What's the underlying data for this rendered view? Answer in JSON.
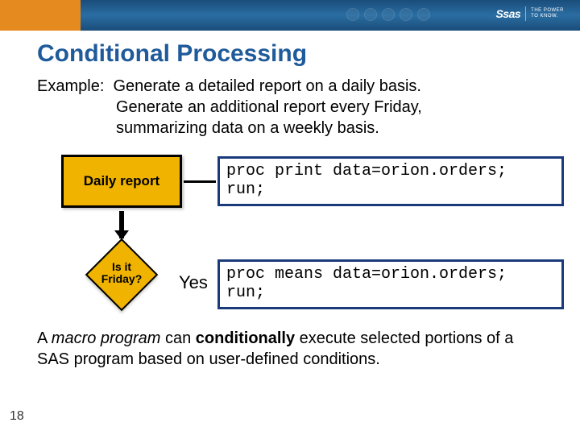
{
  "header": {
    "logo_brand": "Ssas",
    "logo_tag_line1": "THE POWER",
    "logo_tag_line2": "TO KNOW."
  },
  "title": "Conditional Processing",
  "example": {
    "label": "Example:",
    "line1": "Generate a detailed report on a daily basis.",
    "line2": "Generate an additional report every Friday,",
    "line3": "summarizing data on a weekly basis."
  },
  "diagram": {
    "daily_report": "Daily report",
    "code1_line1": "proc print data=orion.orders;",
    "code1_line2": "run;",
    "decision_line1": "Is it",
    "decision_line2": "Friday?",
    "yes": "Yes",
    "code2_line1": "proc means data=orion.orders;",
    "code2_line2": "run;"
  },
  "footer": {
    "part1": "A ",
    "macro_program": "macro program",
    "part2": " can ",
    "conditionally": "conditionally",
    "part3": " execute selected portions of a SAS program based on user-defined conditions."
  },
  "slide_number": "18"
}
